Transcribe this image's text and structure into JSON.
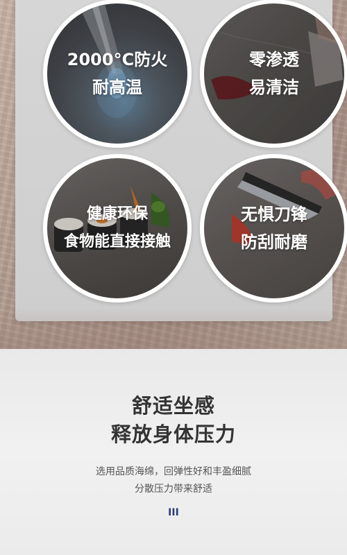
{
  "features": [
    {
      "line1": "2000°C防火",
      "line2": "耐高温",
      "icon": "flame-torch-icon"
    },
    {
      "line1": "零渗透",
      "line2": "易清洁",
      "icon": "wine-spill-icon"
    },
    {
      "line1": "健康环保",
      "line2": "食物能直接接触",
      "icon": "sushi-food-icon"
    },
    {
      "line1": "无惧刀锋",
      "line2": "防刮耐磨",
      "icon": "knife-cut-icon"
    }
  ],
  "headline": {
    "line1": "舒适坐感",
    "line2": "释放身体压力"
  },
  "description": {
    "line1": "选用品质海绵，回弹性好和丰盈细腻",
    "line2": "分散压力带来舒适"
  },
  "indicator": "III",
  "colors": {
    "panel": "#d3d3d3",
    "text_dark": "#333333",
    "indicator": "#2c3a7a"
  }
}
